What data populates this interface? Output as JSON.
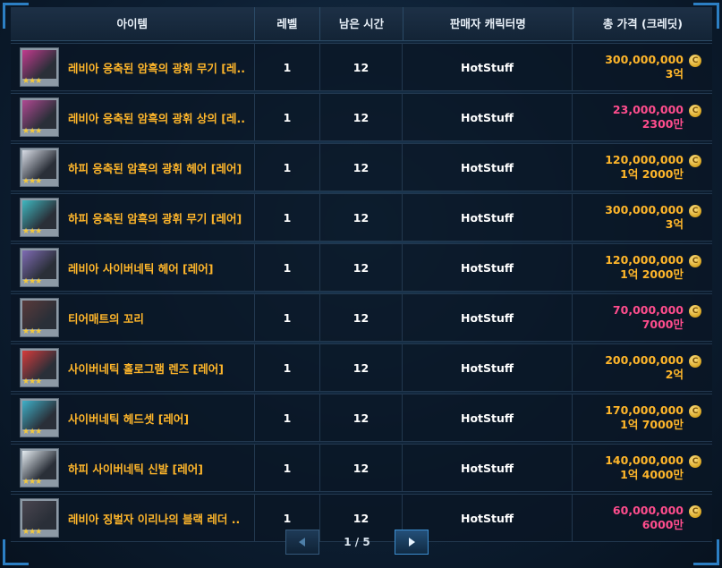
{
  "table": {
    "headers": {
      "item": "아이템",
      "level": "레벨",
      "time": "남은 시간",
      "seller": "판매자 캐릭터명",
      "price": "총 가격 (크레딧)"
    },
    "rows": [
      {
        "name": "레비아 응축된 암흑의 광휘 무기 [레..",
        "level": "1",
        "time": "12",
        "seller": "HotStuff",
        "price": "300,000,000",
        "price_short": "3억",
        "price_color": "orange",
        "icon": "weapon-icon",
        "icon_color": "#c23a8e"
      },
      {
        "name": "레비아 응축된 암흑의 광휘 상의 [레..",
        "level": "1",
        "time": "12",
        "seller": "HotStuff",
        "price": "23,000,000",
        "price_short": "2300만",
        "price_color": "pink",
        "icon": "top-armor-icon",
        "icon_color": "#b04892"
      },
      {
        "name": "하피 응축된 암흑의 광휘 헤어 [레어]",
        "level": "1",
        "time": "12",
        "seller": "HotStuff",
        "price": "120,000,000",
        "price_short": "1억 2000만",
        "price_color": "orange",
        "icon": "hair-icon",
        "icon_color": "#d9dde6"
      },
      {
        "name": "하피 응축된 암흑의 광휘 무기 [레어]",
        "level": "1",
        "time": "12",
        "seller": "HotStuff",
        "price": "300,000,000",
        "price_short": "3억",
        "price_color": "orange",
        "icon": "weapon-icon",
        "icon_color": "#3fb8c0"
      },
      {
        "name": "레비아 사이버네틱 헤어 [레어]",
        "level": "1",
        "time": "12",
        "seller": "HotStuff",
        "price": "120,000,000",
        "price_short": "1억 2000만",
        "price_color": "orange",
        "icon": "hair-icon",
        "icon_color": "#7f6bb4"
      },
      {
        "name": "티어매트의 꼬리",
        "level": "1",
        "time": "12",
        "seller": "HotStuff",
        "price": "70,000,000",
        "price_short": "7000만",
        "price_color": "pink",
        "icon": "tail-icon",
        "icon_color": "#5a3a3a"
      },
      {
        "name": "사이버네틱 홀로그램 렌즈 [레어]",
        "level": "1",
        "time": "12",
        "seller": "HotStuff",
        "price": "200,000,000",
        "price_short": "2억",
        "price_color": "orange",
        "icon": "lens-icon",
        "icon_color": "#d63b3b"
      },
      {
        "name": "사이버네틱 헤드셋 [레어]",
        "level": "1",
        "time": "12",
        "seller": "HotStuff",
        "price": "170,000,000",
        "price_short": "1억 7000만",
        "price_color": "orange",
        "icon": "headset-icon",
        "icon_color": "#3fb0c8"
      },
      {
        "name": "하피 사이버네틱 신발 [레어]",
        "level": "1",
        "time": "12",
        "seller": "HotStuff",
        "price": "140,000,000",
        "price_short": "1억 4000만",
        "price_color": "orange",
        "icon": "shoes-icon",
        "icon_color": "#e6edf2"
      },
      {
        "name": "레비아 징벌자 이리나의 블랙 레더 ..",
        "level": "1",
        "time": "12",
        "seller": "HotStuff",
        "price": "60,000,000",
        "price_short": "6000만",
        "price_color": "pink",
        "icon": "leather-armor-icon",
        "icon_color": "#4a4650"
      }
    ]
  },
  "coin_glyph": "C",
  "stars": "★★★",
  "pager": {
    "indicator": "1 / 5"
  },
  "colors": {
    "item_name": "#ffb62a",
    "price_orange": "#ffb62a",
    "price_pink": "#ff4d8d",
    "accent": "#2c7fc4"
  }
}
